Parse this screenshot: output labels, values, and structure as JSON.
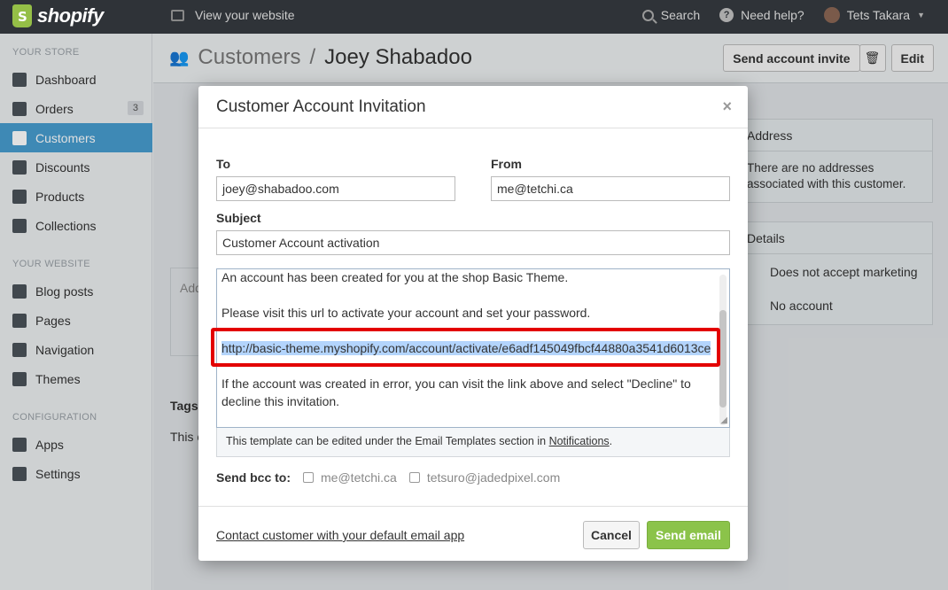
{
  "topbar": {
    "logo_text": "shopify",
    "view_site": "View your website",
    "search": "Search",
    "help": "Need help?",
    "user": "Tets Takara"
  },
  "sidebar": {
    "section_store": "YOUR STORE",
    "section_website": "YOUR WEBSITE",
    "section_config": "CONFIGURATION",
    "items": [
      {
        "label": "Dashboard",
        "icon": "home-icon"
      },
      {
        "label": "Orders",
        "icon": "inbox-icon",
        "badge": "3"
      },
      {
        "label": "Customers",
        "icon": "users-icon",
        "active": true
      },
      {
        "label": "Discounts",
        "icon": "megaphone-icon"
      },
      {
        "label": "Products",
        "icon": "tag-icon"
      },
      {
        "label": "Collections",
        "icon": "box-icon"
      },
      {
        "label": "Blog posts",
        "icon": "blog-icon"
      },
      {
        "label": "Pages",
        "icon": "pages-icon"
      },
      {
        "label": "Navigation",
        "icon": "link-icon"
      },
      {
        "label": "Themes",
        "icon": "image-icon"
      },
      {
        "label": "Apps",
        "icon": "puzzle-icon"
      },
      {
        "label": "Settings",
        "icon": "gear-icon"
      }
    ]
  },
  "page": {
    "crumb": "Customers",
    "separator": "/",
    "title": "Joey Shabadoo",
    "send_invite": "Send account invite",
    "delete_icon": "trash-icon",
    "edit": "Edit",
    "address_title": "Address",
    "address_text_1": "There are no addresses",
    "address_text_2": "associated with this customer.",
    "details_title": "Details",
    "details_marketing": "Does not accept marketing",
    "details_account": "No account",
    "tags": "Tags",
    "add_partial": "Add",
    "this_partial": "This c"
  },
  "modal": {
    "title": "Customer Account Invitation",
    "close": "×",
    "to_label": "To",
    "to_value": "joey@shabadoo.com",
    "from_label": "From",
    "from_value": "me@tetchi.ca",
    "subject_label": "Subject",
    "subject_value": "Customer Account activation",
    "body": {
      "line1": "An account has been created for you at the shop Basic Theme.",
      "line2": "Please visit this url to activate your account and set your password.",
      "url": "http://basic-theme.myshopify.com/account/activate/e6adf145049fbcf44880a3541d6013ce",
      "line3": "If the account was created in error, you can visit the link above and select \"Decline\" to",
      "line4": "decline this invitation."
    },
    "hint_text": "This template can be edited under the Email Templates section in",
    "hint_link": "Notifications",
    "hint_end": ".",
    "bcc_label": "Send bcc to:",
    "bcc_options": [
      "me@tetchi.ca",
      "tetsuro@jadedpixel.com"
    ],
    "contact_link": "Contact customer with your default email app",
    "cancel": "Cancel",
    "send": "Send email"
  },
  "colors": {
    "accent": "#479ccf",
    "send": "#8bc34a",
    "highlight": "#e30000"
  }
}
